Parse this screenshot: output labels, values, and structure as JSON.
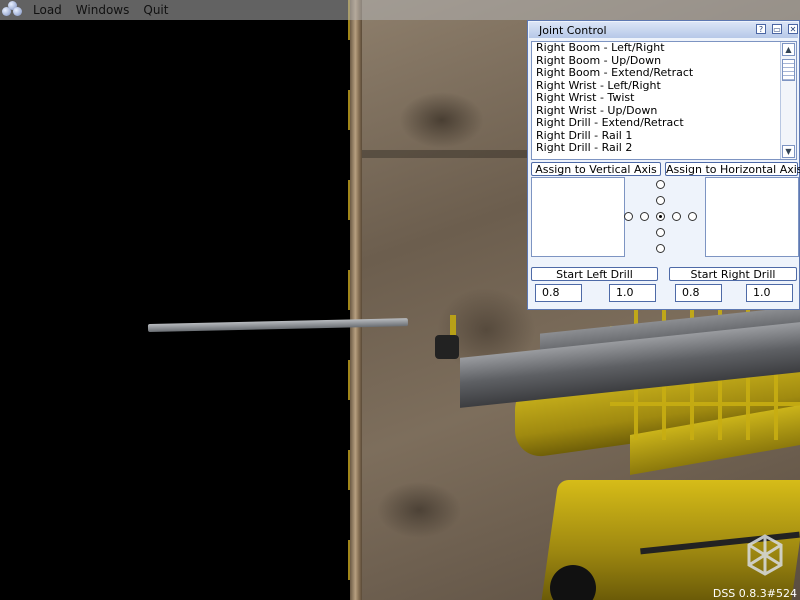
{
  "menubar": {
    "items": [
      "Load",
      "Windows",
      "Quit"
    ]
  },
  "joint_control": {
    "title": "Joint Control",
    "title_buttons": [
      "?",
      "▭",
      "✕"
    ],
    "list_items": [
      "Right Boom - Left/Right",
      "Right Boom - Up/Down",
      "Right Boom - Extend/Retract",
      "Right Wrist - Left/Right",
      "Right Wrist - Twist",
      "Right Wrist - Up/Down",
      "Right Drill - Extend/Retract",
      "Right Drill - Rail 1",
      "Right Drill - Rail 2"
    ],
    "assign_vertical": "Assign to Vertical Axis",
    "assign_horizontal": "Assign to Horizontal Axis",
    "start_left_drill": "Start Left Drill",
    "start_right_drill": "Start Right Drill",
    "left_value_1": "0.8",
    "left_value_2": "1.0",
    "right_value_1": "0.8",
    "right_value_2": "1.0"
  },
  "status": {
    "version": "DSS 0.8.3#524"
  }
}
